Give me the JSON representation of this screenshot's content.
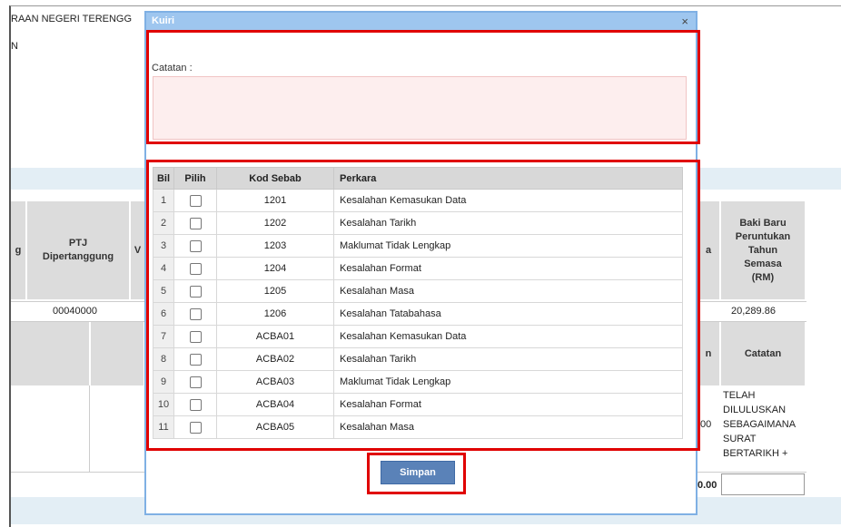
{
  "background": {
    "title_fragment": "RAAN NEGERI TERENGG",
    "left_fragment": "N",
    "headers": {
      "g": "g",
      "ptj": "PTJ\nDipertanggung",
      "v": "V",
      "sa": "a",
      "baki": "Baki Baru\nPeruntukan\nTahun\nSemasa\n(RM)",
      "catatan": "Catatan",
      "n": "n"
    },
    "row": {
      "ptj_value": "00040000",
      "baki_value": "20,289.86"
    },
    "lower": {
      "amount": ".00",
      "note": "TELAH\nDILULUSKAN\nSEBAGAIMANA\nSURAT\nBERTARIKH +",
      "total": "0.00"
    }
  },
  "modal": {
    "title": "Kuiri",
    "close": "×",
    "catatan_label": "Catatan :",
    "catatan_value": "",
    "columns": {
      "bil": "Bil",
      "pilih": "Pilih",
      "kod": "Kod Sebab",
      "perkara": "Perkara"
    },
    "rows": [
      {
        "bil": "1",
        "kod": "1201",
        "perkara": "Kesalahan Kemasukan Data"
      },
      {
        "bil": "2",
        "kod": "1202",
        "perkara": "Kesalahan Tarikh"
      },
      {
        "bil": "3",
        "kod": "1203",
        "perkara": "Maklumat Tidak Lengkap"
      },
      {
        "bil": "4",
        "kod": "1204",
        "perkara": "Kesalahan Format"
      },
      {
        "bil": "5",
        "kod": "1205",
        "perkara": "Kesalahan Masa"
      },
      {
        "bil": "6",
        "kod": "1206",
        "perkara": "Kesalahan Tatabahasa"
      },
      {
        "bil": "7",
        "kod": "ACBA01",
        "perkara": "Kesalahan Kemasukan Data"
      },
      {
        "bil": "8",
        "kod": "ACBA02",
        "perkara": "Kesalahan Tarikh"
      },
      {
        "bil": "9",
        "kod": "ACBA03",
        "perkara": "Maklumat Tidak Lengkap"
      },
      {
        "bil": "10",
        "kod": "ACBA04",
        "perkara": "Kesalahan Format"
      },
      {
        "bil": "11",
        "kod": "ACBA05",
        "perkara": "Kesalahan Masa"
      }
    ],
    "save_label": "Simpan"
  },
  "colors": {
    "highlight": "#e00000",
    "modal_border": "#7fb0e4",
    "button": "#5a82b8"
  }
}
